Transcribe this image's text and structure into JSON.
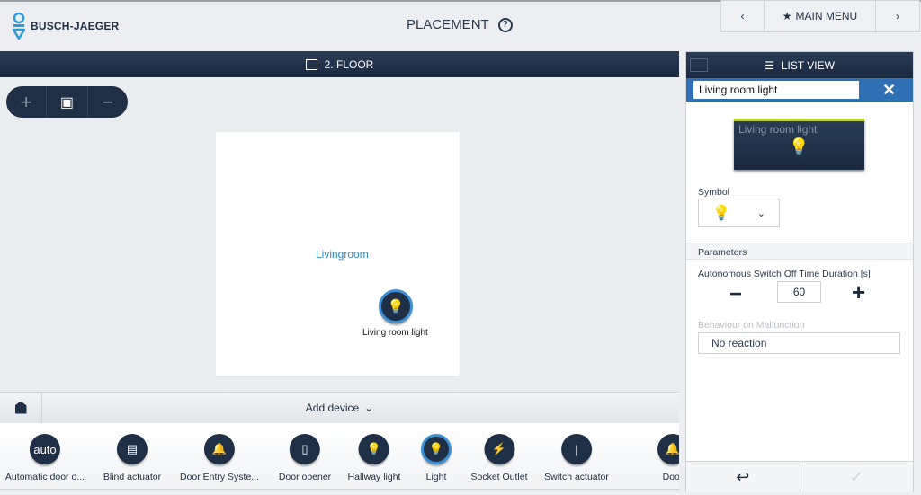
{
  "header": {
    "brand": "BUSCH-JAEGER",
    "title": "PLACEMENT",
    "help_icon": "?",
    "main_menu": "MAIN MENU",
    "prev": "‹",
    "next": "›"
  },
  "floor": {
    "title": "2. FLOOR"
  },
  "zoom": {
    "in": "+",
    "fit": "▣",
    "out": "−"
  },
  "room": {
    "name": "Livingroom",
    "device_label": "Living room light"
  },
  "add_device": {
    "label": "Add device",
    "chevron": "⌄"
  },
  "devices": [
    {
      "label": "Automatic door o...",
      "icon": "auto"
    },
    {
      "label": "Blind actuator",
      "icon": "▤"
    },
    {
      "label": "Door Entry Syste...",
      "icon": "🔔"
    },
    {
      "label": "Door opener",
      "icon": "▯"
    },
    {
      "label": "Hallway light",
      "icon": "💡"
    },
    {
      "label": "Light",
      "icon": "💡",
      "selected": true
    },
    {
      "label": "Socket Outlet",
      "icon": "⚡"
    },
    {
      "label": "Switch actuator",
      "icon": "|"
    },
    {
      "label": "Door",
      "icon": "🔔"
    }
  ],
  "right": {
    "title": "LIST VIEW",
    "search_value": "Living room light",
    "close": "✕",
    "tile_label": "Living room light",
    "symbol_label": "Symbol",
    "parameters_label": "Parameters",
    "duration_label": "Autonomous Switch Off Time Duration [s]",
    "duration_value": "60",
    "minus": "−",
    "plus": "+",
    "malfunction_label": "Behaviour on Malfunction",
    "malfunction_value": "No reaction",
    "back": "↩",
    "confirm": "✓"
  },
  "colors": {
    "dark": "#1f2f45",
    "accent": "#2f6fb3",
    "tile_bar": "#b9d232",
    "room_text": "#2e86c1"
  }
}
